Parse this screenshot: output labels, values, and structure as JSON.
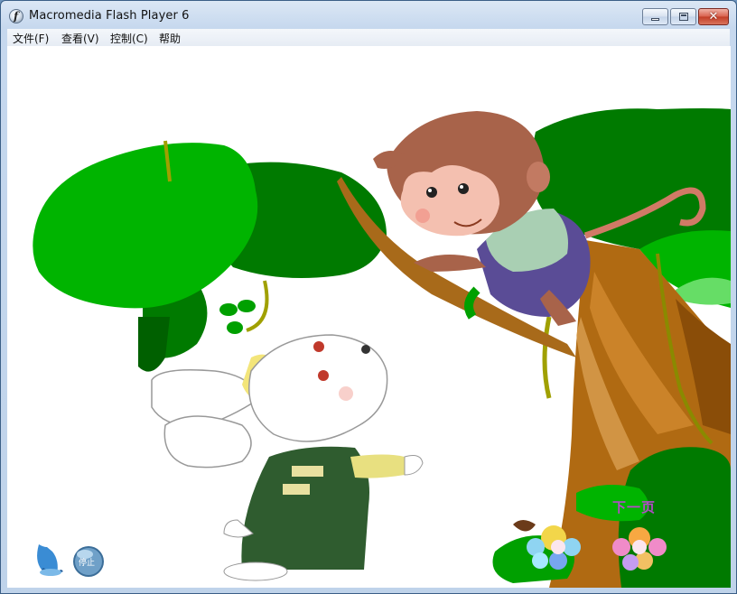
{
  "window": {
    "title": "Macromedia Flash Player 6",
    "icon": "flash-player-icon",
    "controls": {
      "minimize": "minimize-icon",
      "maximize": "maximize-icon",
      "close": "✕"
    }
  },
  "menubar": {
    "items": [
      {
        "label": "文件(F)"
      },
      {
        "label": "查看(V)"
      },
      {
        "label": "控制(C)"
      },
      {
        "label": "帮助"
      }
    ]
  },
  "stage": {
    "scene": "cartoon-monkey-in-tree-and-rabbit",
    "controls": {
      "sound_icon": "bell-speaker-icon",
      "stop_label": "停止",
      "next_label": "下一页"
    },
    "colors": {
      "tree_dark": "#007a00",
      "tree_light": "#00b400",
      "trunk": "#b06a12",
      "overalls": "#2f5c2f",
      "monkey_fur": "#a8634a",
      "next_text": "#b44ac8"
    }
  }
}
